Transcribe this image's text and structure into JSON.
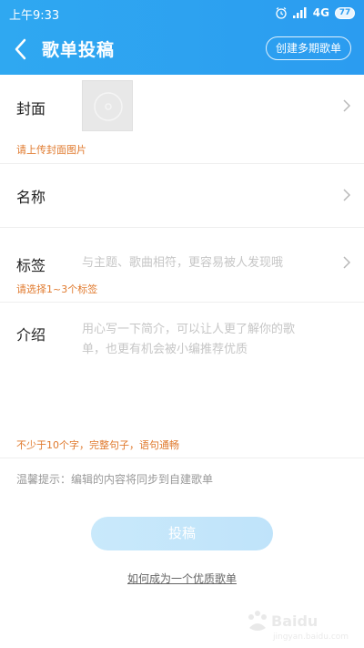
{
  "status_bar": {
    "time": "上午9:33",
    "network": "4G",
    "battery": "77"
  },
  "header": {
    "title": "歌单投稿",
    "create_multi": "创建多期歌单"
  },
  "form": {
    "cover": {
      "label": "封面",
      "hint": "请上传封面图片"
    },
    "name": {
      "label": "名称"
    },
    "tags": {
      "label": "标签",
      "placeholder": "与主题、歌曲相符，更容易被人发现哦",
      "hint": "请选择1~3个标签"
    },
    "intro": {
      "label": "介绍",
      "placeholder_line1": "用心写一下简介，可以让人更了解你的歌",
      "placeholder_line2": "单，也更有机会被小编推荐优质",
      "hint": "不少于10个字，完整句子，语句通畅"
    }
  },
  "tip": "温馨提示：编辑的内容将同步到自建歌单",
  "submit_label": "投稿",
  "help_link": "如何成为一个优质歌单",
  "colors": {
    "header": "#2b9cf0",
    "hint": "#e07a2e",
    "submit_disabled": "#c9e9fb"
  }
}
